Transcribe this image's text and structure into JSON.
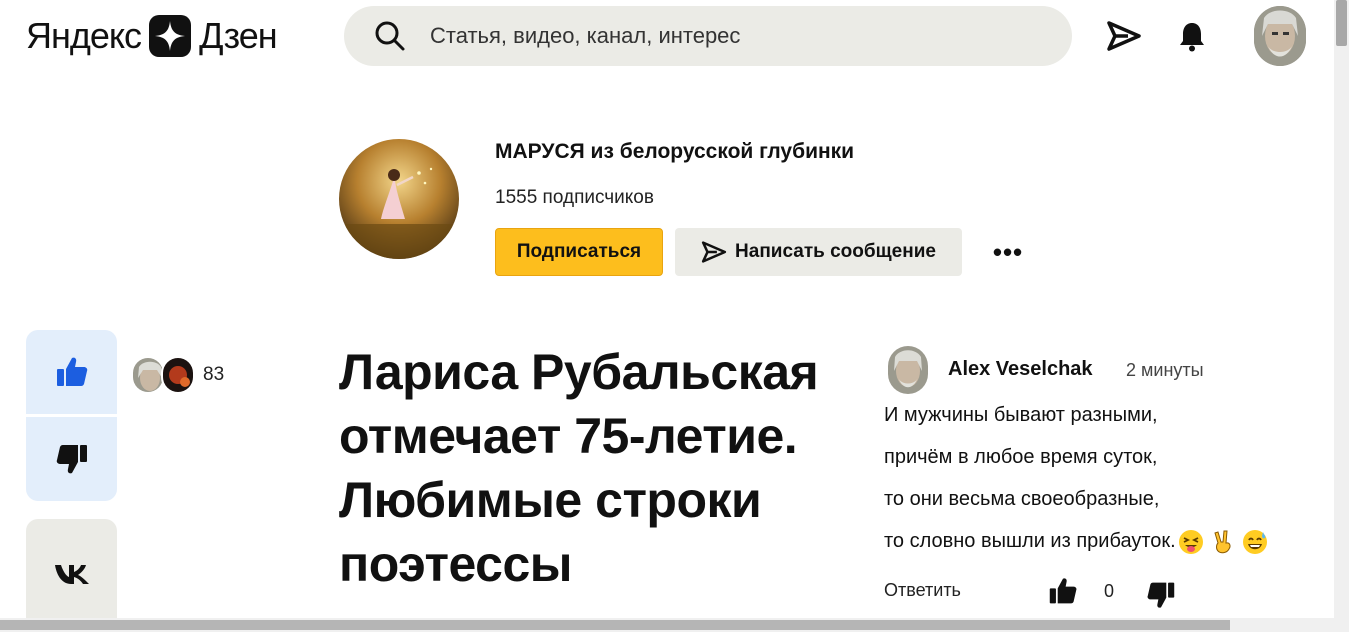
{
  "header": {
    "logo_left": "Яндекс",
    "logo_right": "Дзен",
    "search_placeholder": "Статья, видео, канал, интерес"
  },
  "channel": {
    "name": "МАРУСЯ из белорусской глубинки",
    "subscribers": "1555 подписчиков",
    "subscribe_label": "Подписаться",
    "message_label": "Написать сообщение",
    "more_label": "•••"
  },
  "reactions": {
    "likes_count": "83",
    "vk_label": "vk"
  },
  "article": {
    "title": "Лариса Рубальская отмечает 75-летие. Любимые строки поэтессы"
  },
  "comment": {
    "author": "Alex Veselchak",
    "time": "2 минуты",
    "lines": [
      "И мужчины бывают разными,",
      "причём в любое время суток,",
      "то они весьма своеобразные,",
      "то словно вышли из прибауток."
    ],
    "reply_label": "Ответить",
    "like_count": "0"
  },
  "icons": {
    "search": "search-icon",
    "send": "send-icon",
    "bell": "bell-icon",
    "thumbs_up": "thumbs-up-icon",
    "thumbs_down": "thumbs-down-icon",
    "vk": "vk-icon"
  },
  "colors": {
    "accent_yellow": "#fdbe1d",
    "like_blue": "#1c5ee0",
    "rail_bg": "#e3eefb",
    "chip_bg": "#ebebe6"
  }
}
